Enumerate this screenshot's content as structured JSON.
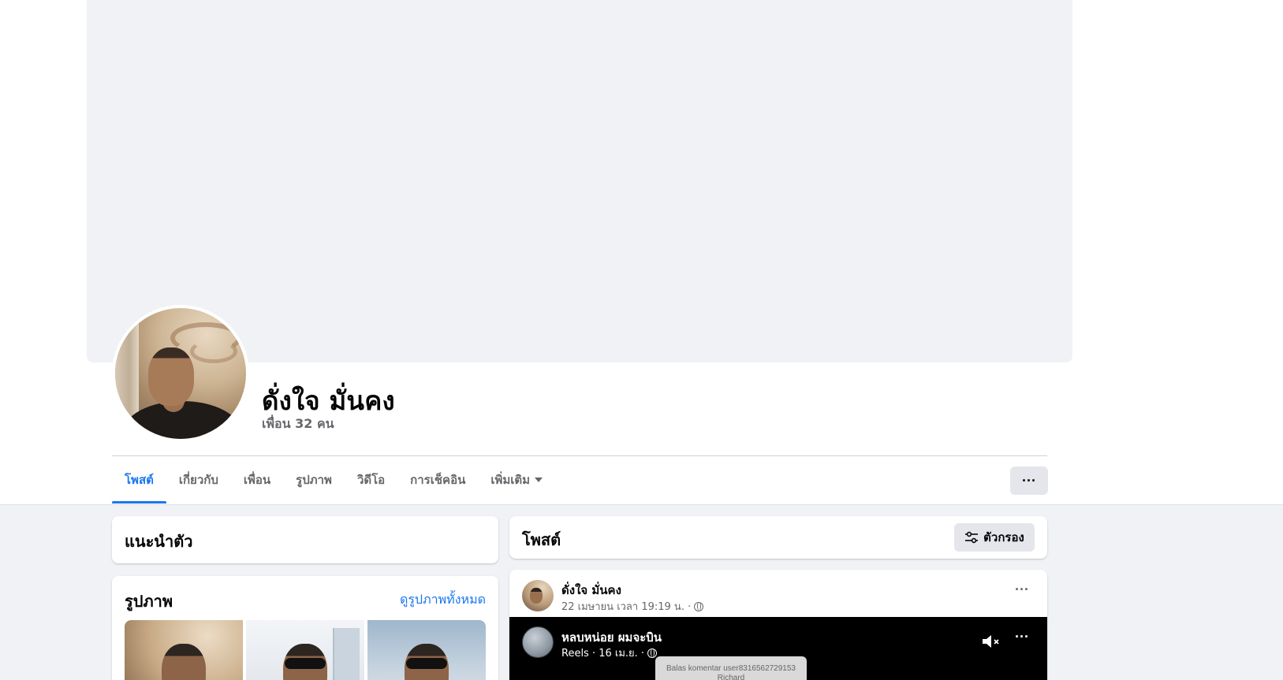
{
  "profile": {
    "name": "ดั่งใจ มั่นคง",
    "friends": "เพื่อน 32 คน"
  },
  "tabs": [
    {
      "label": "โพสต์",
      "active": true
    },
    {
      "label": "เกี่ยวกับ"
    },
    {
      "label": "เพื่อน"
    },
    {
      "label": "รูปภาพ"
    },
    {
      "label": "วิดีโอ"
    },
    {
      "label": "การเช็คอิน"
    },
    {
      "label": "เพิ่มเติม"
    }
  ],
  "more_button": "···",
  "intro": {
    "title": "แนะนำตัว"
  },
  "photos": {
    "title": "รูปภาพ",
    "see_all": "ดูรูปภาพทั้งหมด"
  },
  "posts_header": {
    "title": "โพสต์",
    "filter_label": "ตัวกรอง"
  },
  "post": {
    "author": "ดั่งใจ มั่นคง",
    "time": "22 เมษายน เวลา 19:19 น. ·",
    "more": "···",
    "reel": {
      "author": "หลบหน่อย ผมจะบิน",
      "meta": "Reels · 16 เม.ย. ·",
      "more": "···",
      "bubble_text": "Balas komentar user8316562729153 Richard"
    }
  },
  "colors": {
    "accent": "#1877f2",
    "background": "#f0f2f5",
    "secondary_text": "#65676b",
    "button_bg": "#e4e6eb"
  }
}
